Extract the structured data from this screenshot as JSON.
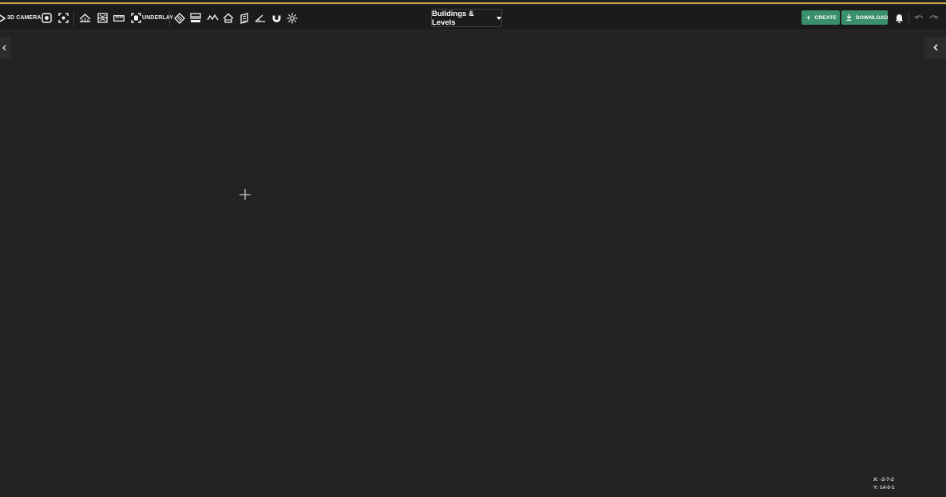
{
  "toolbar": {
    "camera_label": "3D CAMERA",
    "underlay_label": "UNDERLAY",
    "mode_select": {
      "value": "Buildings & Levels"
    },
    "create_label": "CREATE",
    "download_label": "DOWNLOAD"
  },
  "icons": [
    "camera-3d-icon",
    "focus-icon",
    "fit-view-icon",
    "roof-icon",
    "section-icon",
    "ruler-icon",
    "underlay-icon",
    "layers-icon",
    "stairs-icon",
    "terrain-icon",
    "house-icon",
    "facade-icon",
    "angle-icon",
    "magnet-icon",
    "sun-icon",
    "bell-icon",
    "undo-icon",
    "redo-icon"
  ],
  "canvas": {
    "coordinates": {
      "x": "X: -2-7-2",
      "y": "Y: 14-0-1"
    }
  },
  "colors": {
    "accent": "#d4a94a",
    "button_green": "#3a8f6d",
    "background": "#232323",
    "toolbar": "#1b1b1b"
  }
}
